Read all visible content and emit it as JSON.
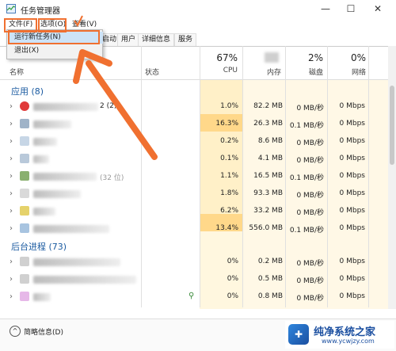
{
  "window": {
    "title": "任务管理器"
  },
  "menu": {
    "file": "文件(F)",
    "options": "选项(O)",
    "view": "查看(V)"
  },
  "dropdown": {
    "items": [
      "运行新任务(N)",
      "退出(X)"
    ]
  },
  "tabs": [
    "启动",
    "用户",
    "详细信息",
    "服务"
  ],
  "columns": {
    "name": "名称",
    "status": "状态",
    "cpu": {
      "pct": "67%",
      "label": "CPU"
    },
    "memory": {
      "label": "内存"
    },
    "disk": {
      "pct": "2%",
      "label": "磁盘"
    },
    "network": {
      "pct": "0%",
      "label": "网络"
    }
  },
  "groups": {
    "apps": "应用 (8)",
    "background": "后台进程 (73)"
  },
  "apps": [
    {
      "name_suffix": "2 (2)",
      "cpu": "1.0%",
      "memory": "82.2 MB",
      "disk": "0 MB/秒",
      "network": "0 Mbps"
    },
    {
      "name_suffix": "",
      "cpu": "16.3%",
      "memory": "26.3 MB",
      "disk": "0.1 MB/秒",
      "network": "0 Mbps"
    },
    {
      "name_suffix": "",
      "cpu": "0.2%",
      "memory": "8.6 MB",
      "disk": "0 MB/秒",
      "network": "0 Mbps"
    },
    {
      "name_suffix": "",
      "cpu": "0.1%",
      "memory": "4.1 MB",
      "disk": "0 MB/秒",
      "network": "0 Mbps"
    },
    {
      "name_suffix": "(32 位)",
      "cpu": "1.1%",
      "memory": "16.5 MB",
      "disk": "0.1 MB/秒",
      "network": "0 Mbps"
    },
    {
      "name_suffix": "",
      "cpu": "1.8%",
      "memory": "93.3 MB",
      "disk": "0 MB/秒",
      "network": "0 Mbps"
    },
    {
      "name_suffix": "",
      "cpu": "6.2%",
      "memory": "33.2 MB",
      "disk": "0 MB/秒",
      "network": "0 Mbps"
    },
    {
      "name_suffix": "",
      "cpu": "13.4%",
      "memory": "556.0 MB",
      "disk": "0.1 MB/秒",
      "network": "0 Mbps"
    }
  ],
  "background": [
    {
      "name_suffix": "",
      "cpu": "0%",
      "memory": "0.2 MB",
      "disk": "0 MB/秒",
      "network": "0 Mbps"
    },
    {
      "name_suffix": "",
      "cpu": "0%",
      "memory": "0.5 MB",
      "disk": "0 MB/秒",
      "network": "0 Mbps"
    },
    {
      "name_suffix": "",
      "cpu": "0%",
      "memory": "0.8 MB",
      "disk": "0 MB/秒",
      "network": "0 Mbps"
    }
  ],
  "footer": {
    "label": "简略信息(D)"
  },
  "watermark": {
    "title": "纯净系统之家",
    "url": "www.ycwjzy.com"
  },
  "colors": {
    "cpu_high": "#ffd88a",
    "cpu_low": "#fff4d6",
    "accent": "#f07030"
  }
}
